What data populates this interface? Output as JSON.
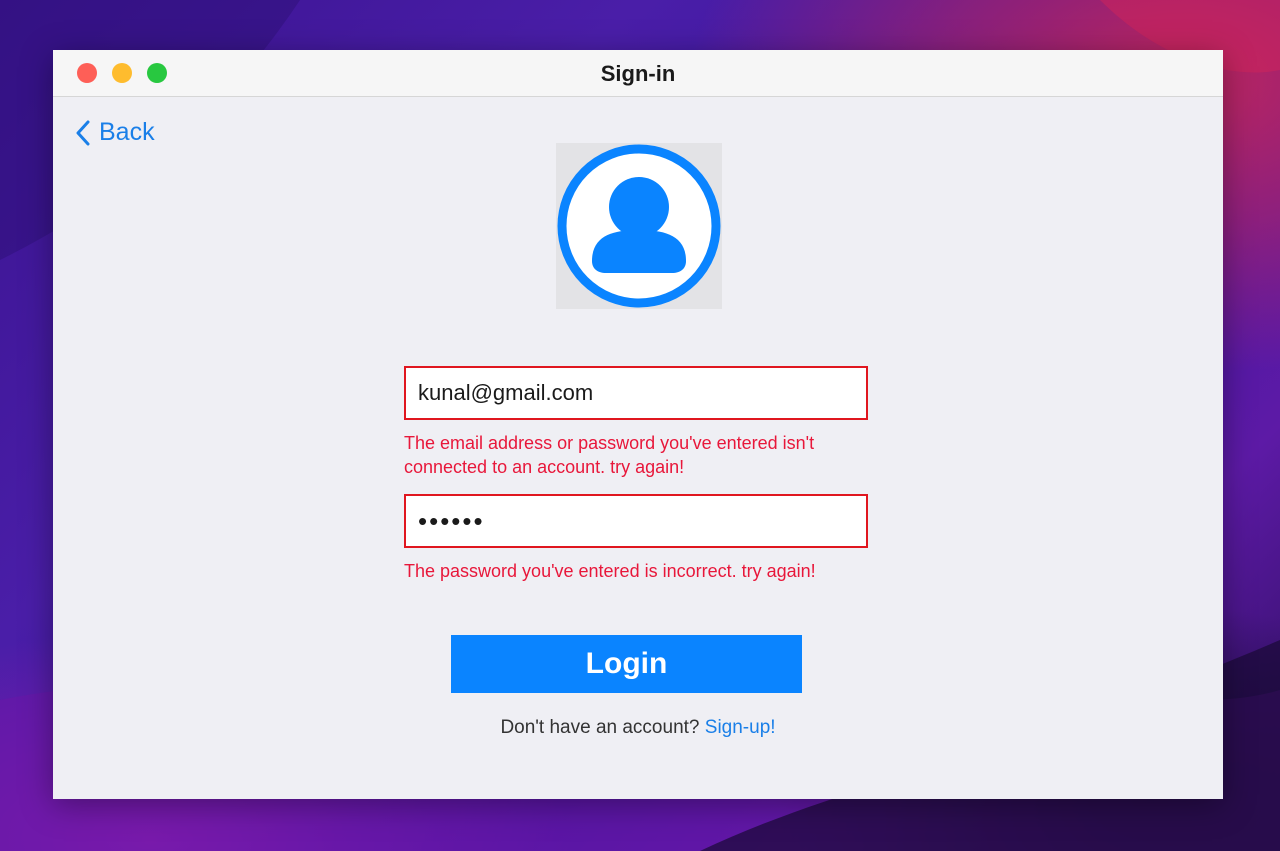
{
  "window": {
    "title": "Sign-in"
  },
  "nav": {
    "back_label": "Back"
  },
  "form": {
    "email_value": "kunal@gmail.com",
    "email_error": "The email address or password you've entered isn't connected to an account. try again!",
    "password_value": "••••••",
    "password_error": "The password you've entered is incorrect. try again!",
    "login_label": "Login"
  },
  "footer": {
    "prompt": "Don't have an account?",
    "signup_label": "Sign-up!"
  },
  "colors": {
    "accent": "#0a84ff",
    "link": "#1a7fe8",
    "error": "#e8173a",
    "error_border": "#e0161f"
  },
  "icons": {
    "avatar": "user-circle-icon",
    "back": "chevron-left-icon"
  }
}
